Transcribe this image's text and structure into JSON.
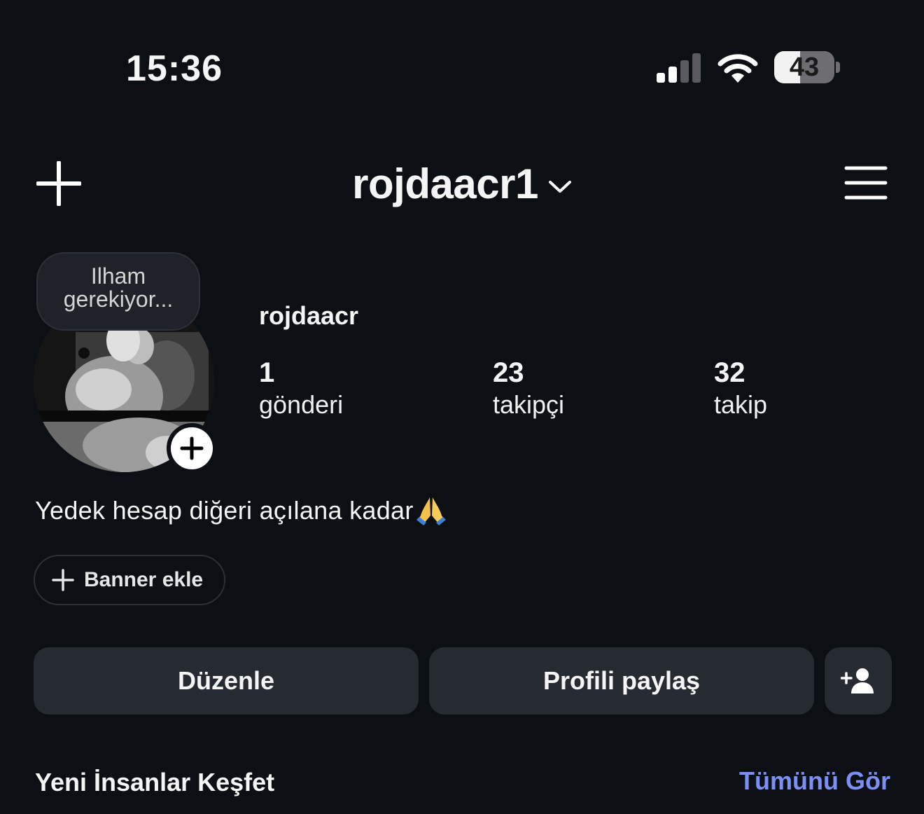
{
  "status_bar": {
    "time": "15:36",
    "battery_level": "43",
    "battery_fraction": 0.43,
    "signal_bars_active": 2,
    "signal_bars_total": 4
  },
  "header": {
    "username": "rojdaacr1",
    "icons": [
      "plus-icon",
      "chevron-down-icon",
      "menu-icon"
    ]
  },
  "profile": {
    "note": "Ilham gerekiyor...",
    "full_name": "rojdaacr",
    "stats": [
      {
        "value": "1",
        "label": "gönderi"
      },
      {
        "value": "23",
        "label": "takipçi"
      },
      {
        "value": "32",
        "label": "takip"
      }
    ],
    "bio": "Yedek hesap diğeri açılana kadar",
    "bio_emoji": "folded-hands-emoji"
  },
  "buttons": {
    "banner": "Banner ekle",
    "edit": "Düzenle",
    "share": "Profili paylaş"
  },
  "discover": {
    "title": "Yeni İnsanlar Keşfet",
    "see_all": "Tümünü Gör"
  },
  "colors": {
    "background": "#0c1014",
    "button": "#262a31",
    "link": "#7b8ff5"
  }
}
